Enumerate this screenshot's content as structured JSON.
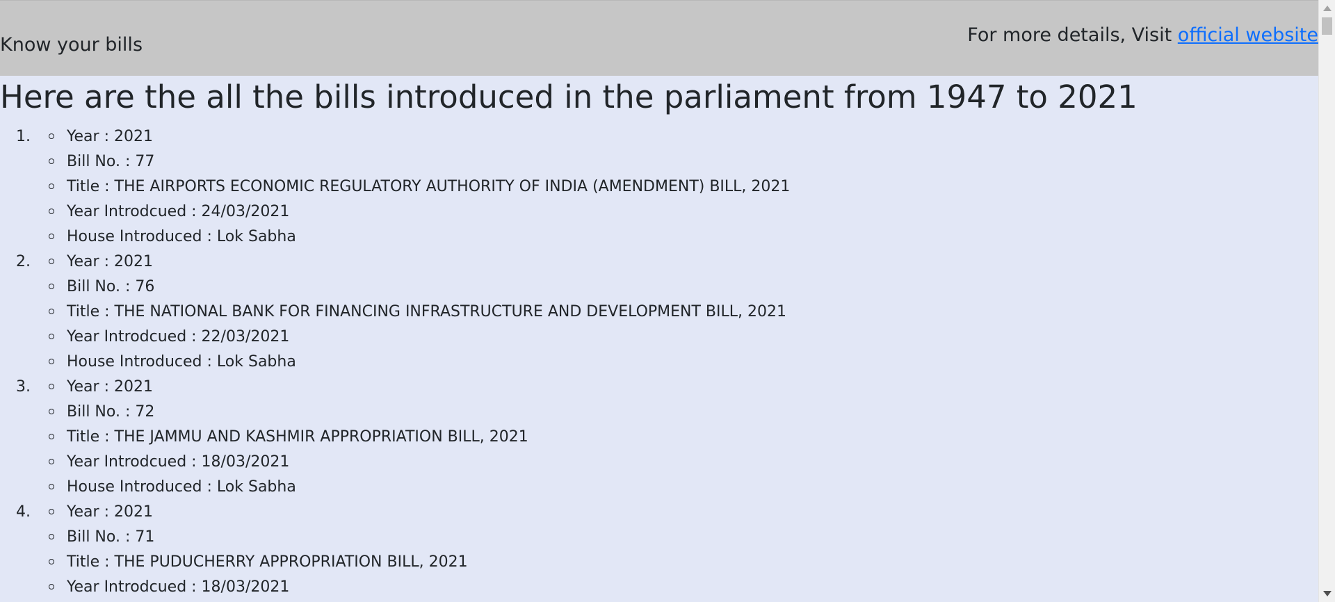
{
  "header": {
    "brand": "Know your bills",
    "details_text": "For more details, Visit ",
    "link_text": "official website"
  },
  "main": {
    "title": "Here are the all the bills introduced in the parliament from 1947 to 2021"
  },
  "bills": [
    {
      "number": "1.",
      "year": "Year : 2021",
      "bill_no": "Bill No. : 77",
      "title": "Title : THE AIRPORTS ECONOMIC REGULATORY AUTHORITY OF INDIA (AMENDMENT) BILL, 2021",
      "introduced": "Year Introdcued : 24/03/2021",
      "house": "House Introduced : Lok Sabha"
    },
    {
      "number": "2.",
      "year": "Year : 2021",
      "bill_no": "Bill No. : 76",
      "title": "Title : THE NATIONAL BANK FOR FINANCING INFRASTRUCTURE AND DEVELOPMENT BILL, 2021",
      "introduced": "Year Introdcued : 22/03/2021",
      "house": "House Introduced : Lok Sabha"
    },
    {
      "number": "3.",
      "year": "Year : 2021",
      "bill_no": "Bill No. : 72",
      "title": "Title : THE JAMMU AND KASHMIR APPROPRIATION BILL, 2021",
      "introduced": "Year Introdcued : 18/03/2021",
      "house": "House Introduced : Lok Sabha"
    },
    {
      "number": "4.",
      "year": "Year : 2021",
      "bill_no": "Bill No. : 71",
      "title": "Title : THE PUDUCHERRY APPROPRIATION BILL, 2021",
      "introduced": "Year Introdcued : 18/03/2021"
    }
  ]
}
